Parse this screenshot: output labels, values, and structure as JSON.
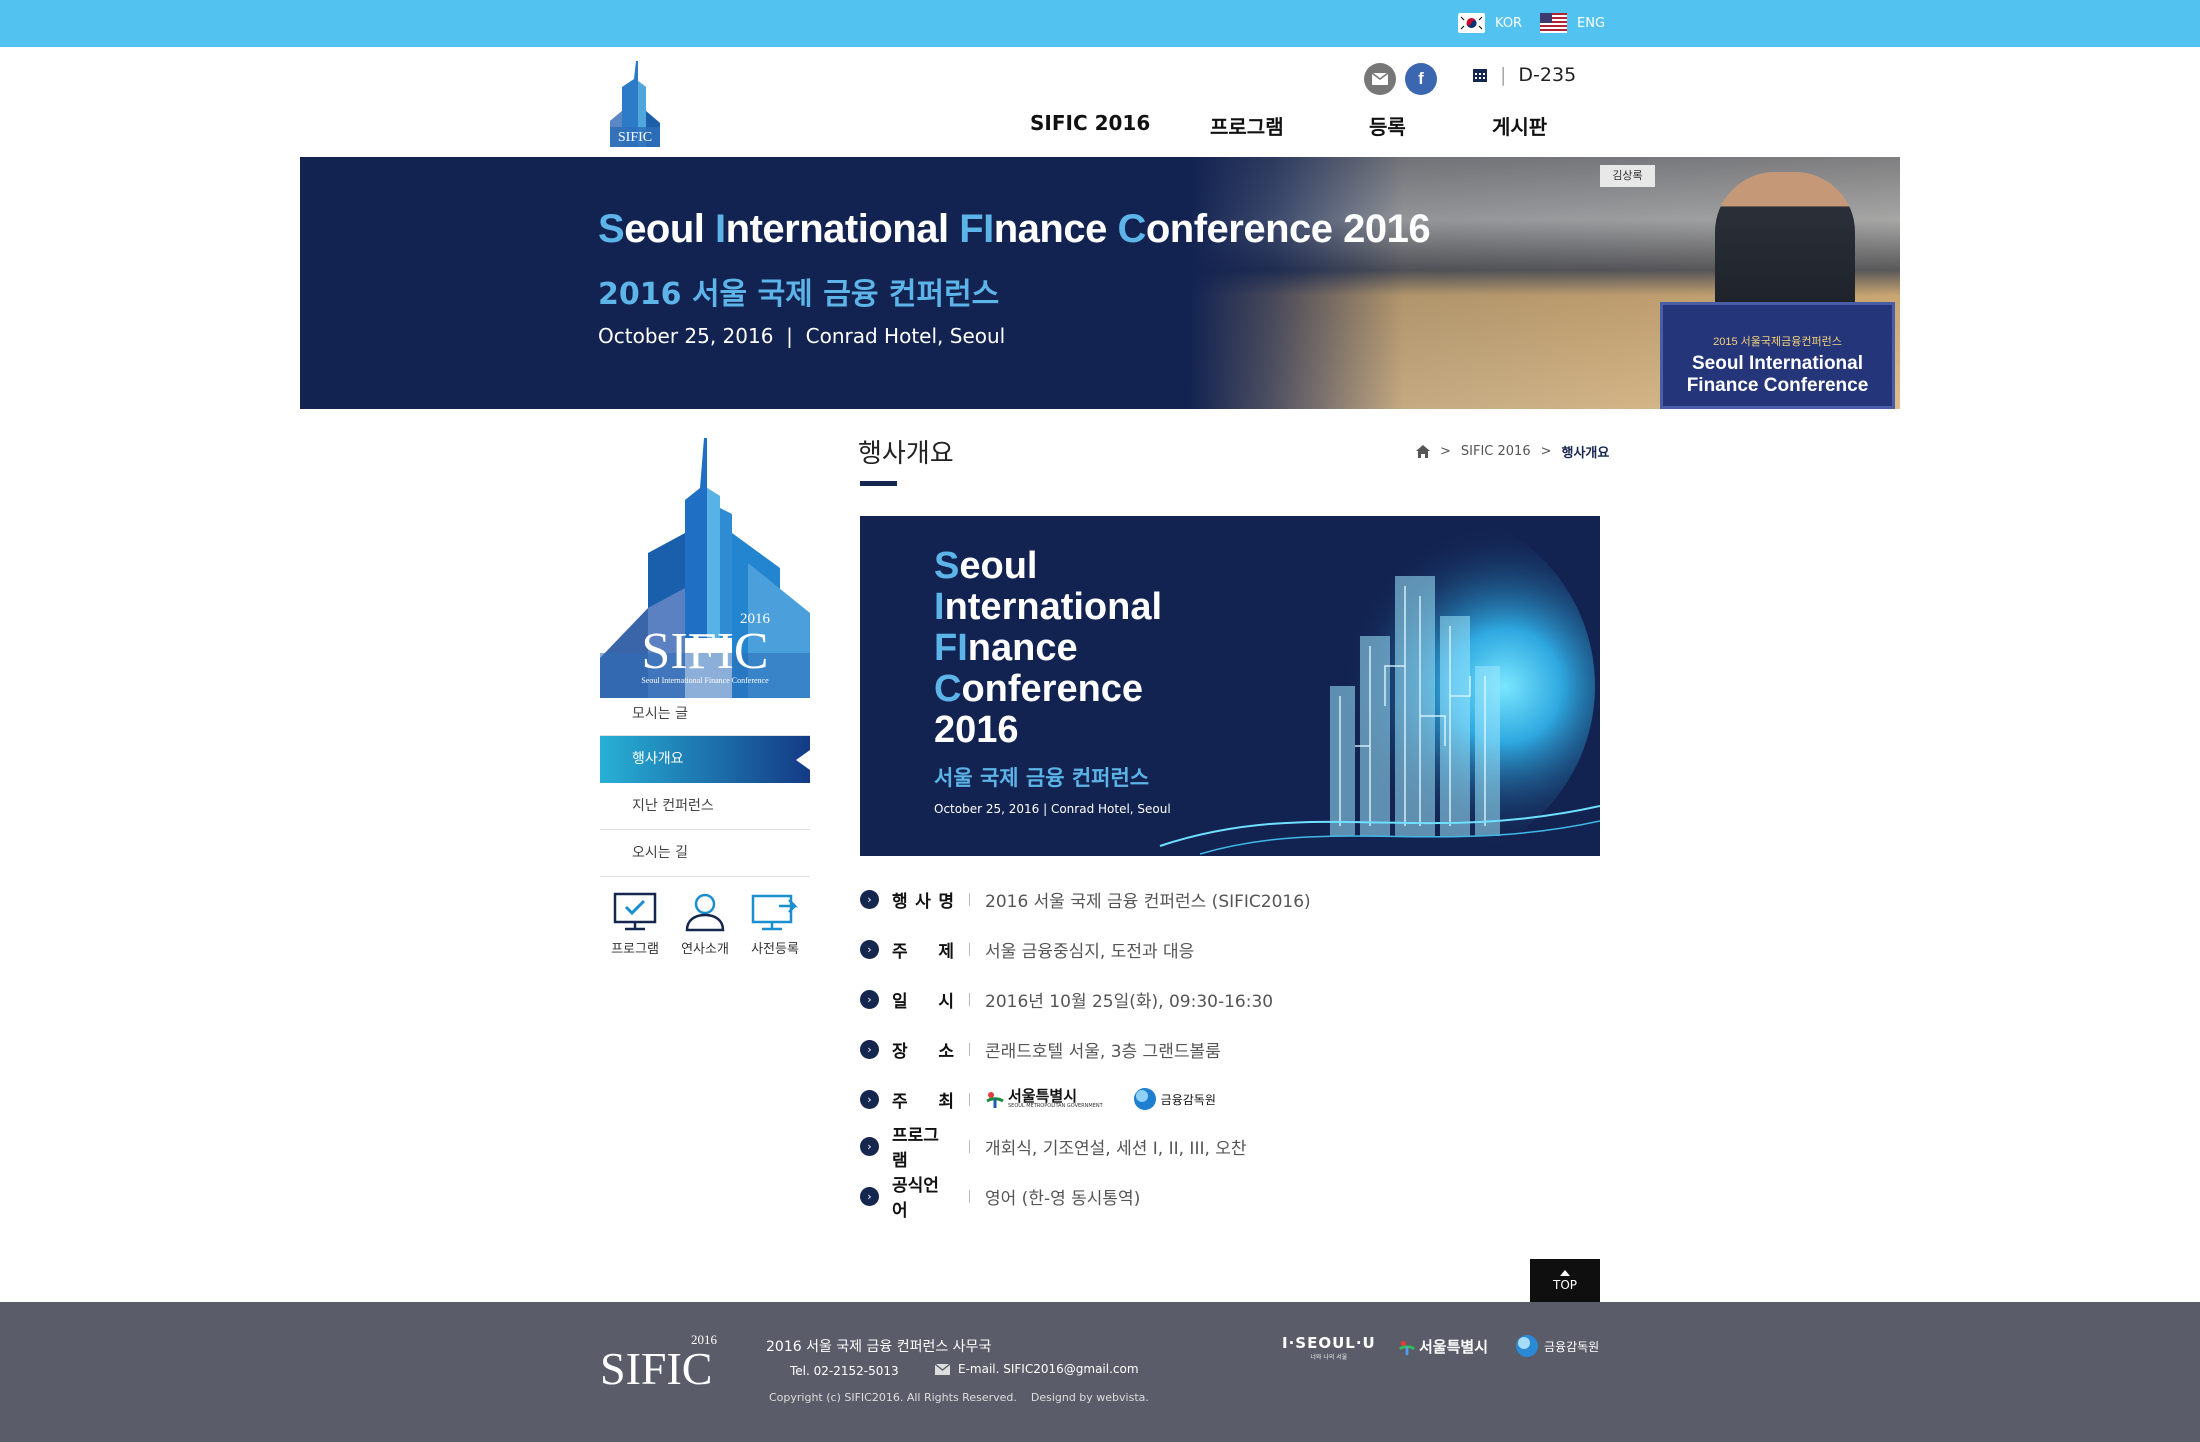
{
  "top_bar": {
    "lang_kor": "KOR",
    "lang_eng": "ENG"
  },
  "header": {
    "logo_text": "SIFIC",
    "dday_label": "D-235",
    "nav": [
      "SIFIC 2016",
      "프로그램",
      "등록",
      "게시판"
    ]
  },
  "banner": {
    "title_parts": [
      [
        "S",
        "eoul "
      ],
      [
        "I",
        "nternational "
      ],
      [
        "FI",
        "nance "
      ],
      [
        "C",
        "onference 2016"
      ]
    ],
    "subtitle": "2016 서울 국제 금융 컨퍼런스",
    "date": "October 25, 2016",
    "venue": "Conrad Hotel, Seoul",
    "podium_line1": "2015 서울국제금융컨퍼런스",
    "podium_line2": "Seoul International",
    "podium_line3": "Finance Conference",
    "nameplate": "김상록"
  },
  "sidebar": {
    "logo_text": "SIFIC",
    "logo_year": "2016",
    "logo_sub": "Seoul International Finance Conference",
    "menu": [
      "모시는 글",
      "행사개요",
      "지난 컨퍼런스",
      "오시는 길"
    ],
    "quick": [
      "프로그램",
      "연사소개",
      "사전등록"
    ]
  },
  "content": {
    "page_title": "행사개요",
    "breadcrumb": [
      "SIFIC 2016",
      "행사개요"
    ],
    "image": {
      "lines": [
        [
          "S",
          "eoul"
        ],
        [
          "I",
          "nternational"
        ],
        [
          "FI",
          "nance"
        ],
        [
          "C",
          "onference"
        ],
        [
          "",
          "2016"
        ]
      ],
      "kor": "서울 국제 금융 컨퍼런스",
      "date": "October 25, 2016",
      "venue": "Conrad Hotel, Seoul"
    },
    "rows": [
      {
        "label": [
          "행",
          "사",
          "명"
        ],
        "value": "2016 서울 국제 금융 컨퍼런스 (SIFIC2016)"
      },
      {
        "label": [
          "주",
          "제"
        ],
        "value": "서울 금융중심지, 도전과 대응"
      },
      {
        "label": [
          "일",
          "시"
        ],
        "value": "2016년 10월 25일(화), 09:30-16:30"
      },
      {
        "label": [
          "장",
          "소"
        ],
        "value": "콘래드호텔 서울, 3층 그랜드볼룸"
      },
      {
        "label": [
          "주",
          "최"
        ],
        "value": "",
        "host1": "서울특별시",
        "host1_sub": "SEOUL METROPOLITAN GOVERNMENT",
        "host2": "금융감독원"
      },
      {
        "label": [
          "프로그램"
        ],
        "value": "개회식, 기조연설, 세션 I, II, III, 오찬"
      },
      {
        "label": [
          "공식언어"
        ],
        "value": "영어 (한-영 동시통역)"
      }
    ]
  },
  "top_button": "TOP",
  "footer": {
    "logo_text": "SIFIC",
    "logo_year": "2016",
    "org": "2016 서울 국제 금융 컨퍼런스 사무국",
    "tel": "Tel. 02-2152-5013",
    "email": "E-mail. SIFIC2016@gmail.com",
    "copyright": "Copyright (c) SIFIC2016. All Rights Reserved.    Designd by webvista.",
    "partner1": "I·SEOUL·U",
    "partner1_sub": "너와 나의 서울",
    "partner2": "서울특별시",
    "partner3": "금융감독원"
  },
  "colors": {
    "top_bar": "#52c3f0",
    "navy": "#132351",
    "accent": "#5cb4e8",
    "footer": "#5a5d69"
  }
}
